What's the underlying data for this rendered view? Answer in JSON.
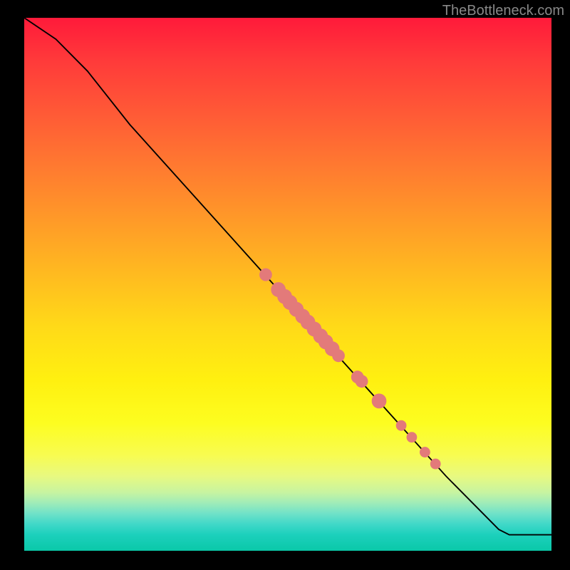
{
  "watermark": "TheBottleneck.com",
  "chart_data": {
    "type": "line",
    "title": "",
    "xlabel": "",
    "ylabel": "",
    "xlim": [
      0,
      100
    ],
    "ylim": [
      0,
      100
    ],
    "curve": [
      {
        "x": 0,
        "y": 100
      },
      {
        "x": 6,
        "y": 96
      },
      {
        "x": 12,
        "y": 90
      },
      {
        "x": 20,
        "y": 80
      },
      {
        "x": 30,
        "y": 69
      },
      {
        "x": 40,
        "y": 58
      },
      {
        "x": 50,
        "y": 47
      },
      {
        "x": 60,
        "y": 36
      },
      {
        "x": 70,
        "y": 25
      },
      {
        "x": 80,
        "y": 14
      },
      {
        "x": 90,
        "y": 4
      },
      {
        "x": 92,
        "y": 3
      },
      {
        "x": 100,
        "y": 3
      }
    ],
    "points": [
      {
        "x": 45.8,
        "y": 51.8,
        "r": 1.2
      },
      {
        "x": 48.2,
        "y": 49.0,
        "r": 1.4
      },
      {
        "x": 49.4,
        "y": 47.7,
        "r": 1.4
      },
      {
        "x": 50.4,
        "y": 46.6,
        "r": 1.4
      },
      {
        "x": 51.6,
        "y": 45.3,
        "r": 1.4
      },
      {
        "x": 52.8,
        "y": 44.0,
        "r": 1.4
      },
      {
        "x": 53.8,
        "y": 42.9,
        "r": 1.4
      },
      {
        "x": 55.0,
        "y": 41.6,
        "r": 1.4
      },
      {
        "x": 56.2,
        "y": 40.3,
        "r": 1.4
      },
      {
        "x": 57.2,
        "y": 39.2,
        "r": 1.4
      },
      {
        "x": 58.4,
        "y": 37.9,
        "r": 1.4
      },
      {
        "x": 59.6,
        "y": 36.6,
        "r": 1.2
      },
      {
        "x": 63.2,
        "y": 32.6,
        "r": 1.2
      },
      {
        "x": 64.0,
        "y": 31.8,
        "r": 1.2
      },
      {
        "x": 67.3,
        "y": 28.1,
        "r": 1.4
      },
      {
        "x": 71.5,
        "y": 23.5,
        "r": 1.0
      },
      {
        "x": 73.5,
        "y": 21.3,
        "r": 1.0
      },
      {
        "x": 76.0,
        "y": 18.5,
        "r": 1.0
      },
      {
        "x": 78.0,
        "y": 16.3,
        "r": 1.0
      }
    ],
    "point_color": "#e37a7a",
    "curve_color": "#000000"
  }
}
